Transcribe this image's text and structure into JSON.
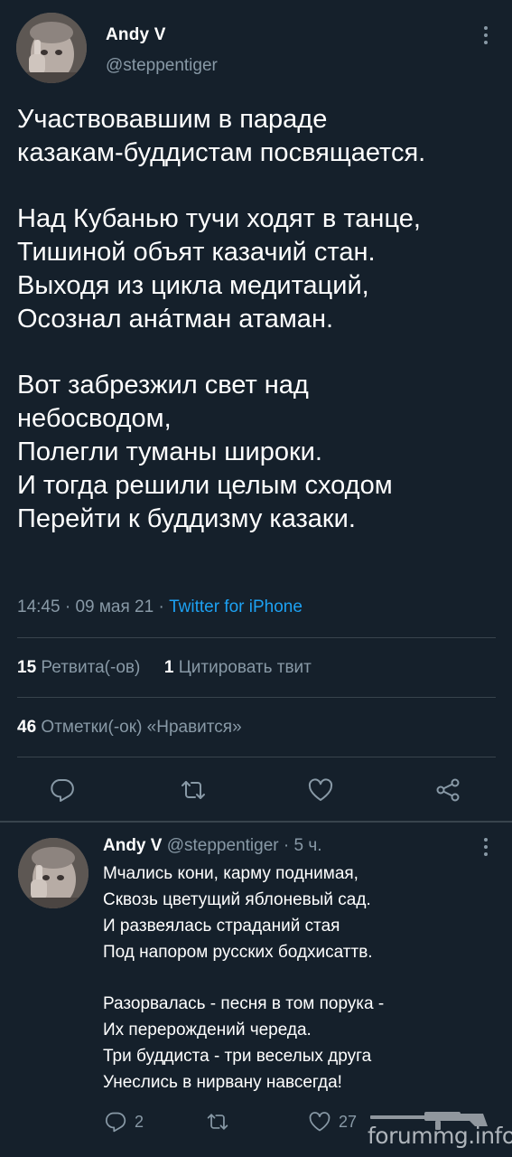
{
  "main_tweet": {
    "author_name": "Andy V",
    "author_handle": "@steppentiger",
    "text_lines": [
      "Участвовавшим в параде",
      "казакам-буддистам посвящается.",
      "",
      "Над Кубанью тучи ходят в танце,",
      "Тишиной объят казачий стан.",
      "Выходя из цикла медитаций,",
      "Осознал ана́тман атаман.",
      "",
      "Вот забрезжил свет над",
      "небосводом,",
      "Полегли туманы широки.",
      "И тогда решили целым сходом",
      "Перейти к буддизму казаки."
    ],
    "time": "14:45",
    "date": "09 мая 21",
    "source": "Twitter for iPhone",
    "retweets_count": "15",
    "retweets_label": "Ретвита(-ов)",
    "quotes_count": "1",
    "quotes_label": "Цитировать твит",
    "likes_count": "46",
    "likes_label": "Отметки(-ок) «Нравится»"
  },
  "reply_tweet": {
    "author_name": "Andy V",
    "author_handle": "@steppentiger",
    "age": "5 ч.",
    "text_lines": [
      "Мчались кони, карму поднимая,",
      "Сквозь цветущий яблоневый сад.",
      "И развеялась страданий стая",
      "Под напором русских бодхисаттв.",
      "",
      "Разорвалась - песня в том порука -",
      "Их перерождений череда.",
      "Три буддиста - три веселых друга",
      "Унеслись в нирвану навсегда!"
    ],
    "reply_count": "2",
    "like_count": "27"
  },
  "watermark": "forummg.info",
  "icons": [
    "more-icon",
    "reply-icon",
    "retweet-icon",
    "like-icon",
    "share-icon"
  ],
  "colors": {
    "background": "#15202b",
    "text": "#ffffff",
    "secondary": "#8899a6",
    "link": "#1da1f2",
    "divider": "#38444d"
  }
}
